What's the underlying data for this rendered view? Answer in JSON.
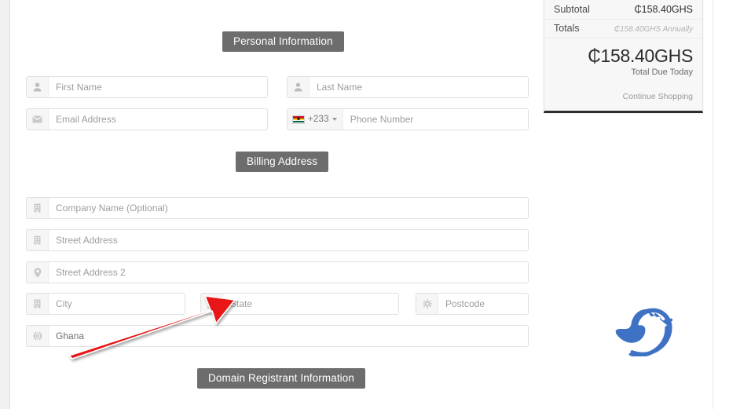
{
  "sections": {
    "personal": "Personal Information",
    "billing": "Billing Address",
    "domain": "Domain Registrant Information"
  },
  "personal_fields": {
    "first_name": {
      "placeholder": "First Name",
      "icon": "user-icon"
    },
    "last_name": {
      "placeholder": "Last Name",
      "icon": "user-icon"
    },
    "email": {
      "placeholder": "Email Address",
      "icon": "envelope-icon"
    },
    "phone": {
      "placeholder": "Phone Number",
      "icon": "flag-icon",
      "dial_code": "+233",
      "country_flag": "Ghana"
    }
  },
  "billing_fields": {
    "company": {
      "placeholder": "Company Name (Optional)",
      "icon": "building-icon"
    },
    "street": {
      "placeholder": "Street Address",
      "icon": "building-icon"
    },
    "street2": {
      "placeholder": "Street Address 2",
      "icon": "map-pin-icon"
    },
    "city": {
      "placeholder": "City",
      "icon": "building-icon"
    },
    "state": {
      "placeholder": "State",
      "icon": "sitemap-icon"
    },
    "postcode": {
      "placeholder": "Postcode",
      "icon": "gear-icon"
    },
    "country": {
      "value": "Ghana",
      "icon": "globe-icon"
    }
  },
  "summary": {
    "subtotal_label": "Subtotal",
    "subtotal_value": "₵158.40GHS",
    "totals_label": "Totals",
    "totals_value": "₵158.40GHS Annually",
    "total_amount": "₵158.40GHS",
    "total_due_label": "Total Due Today",
    "continue_label": "Continue Shopping",
    "accent_top": "#3fa142",
    "accent_bottom": "#2d2d2d"
  },
  "branding": {
    "logo": "bird-logo",
    "logo_color": "#3f72c4"
  },
  "annotation": {
    "arrow_color": "#e81818",
    "points_to": "state-field"
  }
}
